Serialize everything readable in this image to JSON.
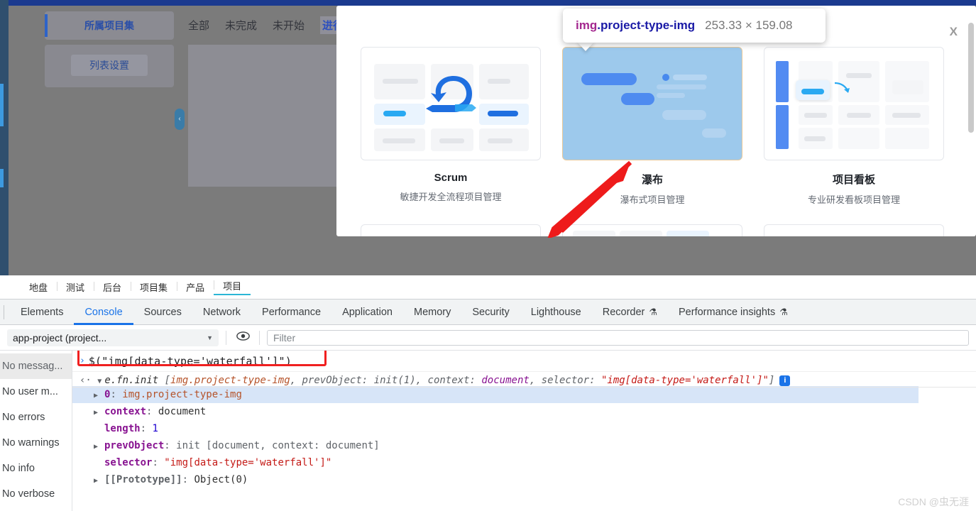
{
  "page": {
    "filters": [
      "全部",
      "未完成",
      "未开始",
      "进行中"
    ],
    "active_filter": "进行中",
    "project_set_label": "所属项目集",
    "list_settings_label": "列表设置",
    "collapse_icon": "chevron-left-icon"
  },
  "modal": {
    "close_label": "X",
    "cards": [
      {
        "title": "Scrum",
        "subtitle": "敏捷开发全流程项目管理",
        "thumb": "scrum-thumbnail"
      },
      {
        "title": "瀑布",
        "subtitle": "瀑布式项目管理",
        "thumb": "waterfall-thumbnail-highlighted"
      },
      {
        "title": "项目看板",
        "subtitle": "专业研发看板项目管理",
        "thumb": "kanban-thumbnail"
      }
    ]
  },
  "inspector_tooltip": {
    "tag": "img",
    "class": ".project-type-img",
    "dimensions": "253.33 × 159.08"
  },
  "site_nav": {
    "items": [
      "地盘",
      "测试",
      "后台",
      "项目集",
      "产品",
      "项目"
    ],
    "active": "项目"
  },
  "devtools": {
    "tabs": [
      {
        "label": "Elements",
        "icon": ""
      },
      {
        "label": "Console",
        "icon": ""
      },
      {
        "label": "Sources",
        "icon": ""
      },
      {
        "label": "Network",
        "icon": ""
      },
      {
        "label": "Performance",
        "icon": ""
      },
      {
        "label": "Application",
        "icon": ""
      },
      {
        "label": "Memory",
        "icon": ""
      },
      {
        "label": "Security",
        "icon": ""
      },
      {
        "label": "Lighthouse",
        "icon": ""
      },
      {
        "label": "Recorder",
        "icon": "⚗"
      },
      {
        "label": "Performance insights",
        "icon": "⚗"
      }
    ],
    "selected_tab": "Console",
    "toolbar": {
      "context_value": "app-project (project...",
      "context_caret": "▼",
      "eye_icon": "eye-icon",
      "filter_placeholder": "Filter"
    },
    "sidebar": {
      "items": [
        "No messag...",
        "No user m...",
        "No errors",
        "No warnings",
        "No info",
        "No verbose"
      ],
      "selected": "No messag..."
    },
    "console": {
      "prompt_chevron": "›",
      "command": "$(\"img[data-type='waterfall']\")",
      "result_marker": "‹·",
      "result_toggle": "▼",
      "result_head_1": "e.fn.init",
      "result_head_2": " [",
      "result_head_3": "img.project-type-img",
      "result_head_4": ", prevObject: ",
      "result_head_5": "init(1)",
      "result_head_6": ", context: ",
      "result_head_7": "document",
      "result_head_8": ", selector: ",
      "result_head_9": "\"img[data-type='waterfall']\"",
      "result_head_10": "]",
      "info_badge": "i",
      "props": [
        {
          "tri": "▶",
          "name": "0",
          "sep": ": ",
          "value": "img.project-type-img",
          "vclass": "k-obj",
          "nclass": "k-purple",
          "selected": true
        },
        {
          "tri": "▶",
          "name": "context",
          "sep": ": ",
          "value": "document",
          "vclass": "k-dark",
          "nclass": "k-purple",
          "selected": false
        },
        {
          "tri": "",
          "name": "length",
          "sep": ": ",
          "value": "1",
          "vclass": "k-num",
          "nclass": "k-purple",
          "selected": false
        },
        {
          "tri": "▶",
          "name": "prevObject",
          "sep": ": ",
          "value": "init [document, context: document]",
          "vclass": "k-grey",
          "nclass": "k-purple",
          "selected": false
        },
        {
          "tri": "",
          "name": "selector",
          "sep": ": ",
          "value": "\"img[data-type='waterfall']\"",
          "vclass": "k-str",
          "nclass": "k-purple",
          "selected": false
        },
        {
          "tri": "▶",
          "name": "[[Prototype]]",
          "sep": ": ",
          "value": "Object(0)",
          "vclass": "k-dark",
          "nclass": "pname-grey",
          "selected": false
        }
      ]
    }
  },
  "watermark": "CSDN @虫无涯",
  "colors": {
    "accent_blue": "#1a73e8",
    "highlight_overlay": "#9dc9ec",
    "highlight_padding": "#f6d5ab",
    "annotation_red": "#f02020",
    "tooltip_tag": "#a4288f",
    "tooltip_class": "#1a1aa6"
  }
}
